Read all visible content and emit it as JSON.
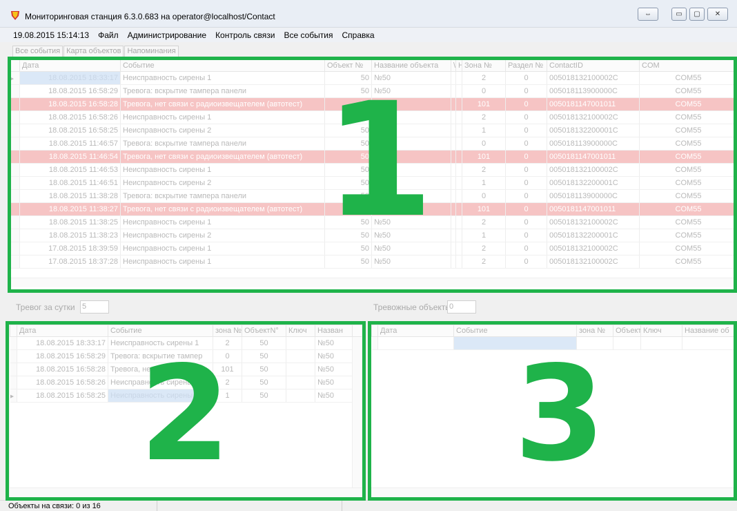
{
  "window": {
    "title": "Мониторинговая станция 6.3.0.683 на operator@localhost/Contact"
  },
  "menu": {
    "datetime": "19.08.2015 15:14:13",
    "items": [
      "Файл",
      "Администрирование",
      "Контроль связи",
      "Все события",
      "Справка"
    ]
  },
  "tabs": [
    "Все события",
    "Карта объектов",
    "Напоминания"
  ],
  "main_grid": {
    "columns": [
      "Дата",
      "Событие",
      "Объект №",
      "Название объекта",
      "\\",
      "H",
      "Зона №",
      "Раздел №",
      "ContactID",
      "COM"
    ],
    "rows": [
      {
        "date": "18.08.2015 18:33:17",
        "event": "Неисправность сирены 1",
        "object": "50",
        "name": "№50",
        "zone": "2",
        "part": "0",
        "cid": "005018132100002C",
        "com": "COM55",
        "alarm": false
      },
      {
        "date": "18.08.2015 16:58:29",
        "event": "Тревога: вскрытие тампера панели",
        "object": "50",
        "name": "№50",
        "zone": "0",
        "part": "0",
        "cid": "005018113900000C",
        "com": "COM55",
        "alarm": false
      },
      {
        "date": "18.08.2015 16:58:28",
        "event": "Тревога, нет связи с радиоизвещателем (автотест)",
        "object": "50",
        "name": "№50",
        "zone": "101",
        "part": "0",
        "cid": "0050181147001011",
        "com": "COM55",
        "alarm": true
      },
      {
        "date": "18.08.2015 16:58:26",
        "event": "Неисправность сирены 1",
        "object": "50",
        "name": "№50",
        "zone": "2",
        "part": "0",
        "cid": "005018132100002C",
        "com": "COM55",
        "alarm": false
      },
      {
        "date": "18.08.2015 16:58:25",
        "event": "Неисправность сирены 2",
        "object": "50",
        "name": "№50",
        "zone": "1",
        "part": "0",
        "cid": "005018132200001C",
        "com": "COM55",
        "alarm": false
      },
      {
        "date": "18.08.2015 11:46:57",
        "event": "Тревога: вскрытие тампера панели",
        "object": "50",
        "name": "№50",
        "zone": "0",
        "part": "0",
        "cid": "005018113900000C",
        "com": "COM55",
        "alarm": false
      },
      {
        "date": "18.08.2015 11:46:54",
        "event": "Тревога, нет связи с радиоизвещателем (автотест)",
        "object": "50",
        "name": "№50",
        "zone": "101",
        "part": "0",
        "cid": "0050181147001011",
        "com": "COM55",
        "alarm": true
      },
      {
        "date": "18.08.2015 11:46:53",
        "event": "Неисправность сирены 1",
        "object": "50",
        "name": "№50",
        "zone": "2",
        "part": "0",
        "cid": "005018132100002C",
        "com": "COM55",
        "alarm": false
      },
      {
        "date": "18.08.2015 11:46:51",
        "event": "Неисправность сирены 2",
        "object": "50",
        "name": "№50",
        "zone": "1",
        "part": "0",
        "cid": "005018132200001C",
        "com": "COM55",
        "alarm": false
      },
      {
        "date": "18.08.2015 11:38:28",
        "event": "Тревога: вскрытие тампера панели",
        "object": "50",
        "name": "№50",
        "zone": "0",
        "part": "0",
        "cid": "005018113900000C",
        "com": "COM55",
        "alarm": false
      },
      {
        "date": "18.08.2015 11:38:27",
        "event": "Тревога, нет связи с радиоизвещателем (автотест)",
        "object": "50",
        "name": "№50",
        "zone": "101",
        "part": "0",
        "cid": "0050181147001011",
        "com": "COM55",
        "alarm": true
      },
      {
        "date": "18.08.2015 11:38:25",
        "event": "Неисправность сирены 1",
        "object": "50",
        "name": "№50",
        "zone": "2",
        "part": "0",
        "cid": "005018132100002C",
        "com": "COM55",
        "alarm": false
      },
      {
        "date": "18.08.2015 11:38:23",
        "event": "Неисправность сирены 2",
        "object": "50",
        "name": "№50",
        "zone": "1",
        "part": "0",
        "cid": "005018132200001C",
        "com": "COM55",
        "alarm": false
      },
      {
        "date": "17.08.2015 18:39:59",
        "event": "Неисправность сирены 1",
        "object": "50",
        "name": "№50",
        "zone": "2",
        "part": "0",
        "cid": "005018132100002C",
        "com": "COM55",
        "alarm": false
      },
      {
        "date": "17.08.2015 18:37:28",
        "event": "Неисправность сирены 1",
        "object": "50",
        "name": "№50",
        "zone": "2",
        "part": "0",
        "cid": "005018132100002C",
        "com": "COM55",
        "alarm": false
      }
    ]
  },
  "counters": {
    "alarms_label": "Тревог за сутки",
    "alarms_value": "5",
    "objects_label": "Тревожные объекты",
    "objects_value": "0"
  },
  "left_grid": {
    "columns": [
      "Дата",
      "Событие",
      "зона №",
      "ОбъектN°",
      "Ключ",
      "Назван"
    ],
    "rows": [
      {
        "date": "18.08.2015 18:33:17",
        "event": "Неисправность сирены 1",
        "zone": "2",
        "object": "50",
        "key": "",
        "name": "№50"
      },
      {
        "date": "18.08.2015 16:58:29",
        "event": "Тревога: вскрытие тампер",
        "zone": "0",
        "object": "50",
        "key": "",
        "name": "№50"
      },
      {
        "date": "18.08.2015 16:58:28",
        "event": "Тревога, нет связи с",
        "zone": "101",
        "object": "50",
        "key": "",
        "name": "№50"
      },
      {
        "date": "18.08.2015 16:58:26",
        "event": "Неисправность сирены",
        "zone": "2",
        "object": "50",
        "key": "",
        "name": "№50"
      },
      {
        "date": "18.08.2015 16:58:25",
        "event": "Неисправность сирены",
        "zone": "1",
        "object": "50",
        "key": "",
        "name": "№50"
      }
    ]
  },
  "right_grid": {
    "columns": [
      "Дата",
      "Событие",
      "зона №",
      "Объект!",
      "Ключ",
      "Название об"
    ]
  },
  "status": {
    "online": "Объекты на связи: 0 из 16"
  },
  "highlights": [
    "1",
    "2",
    "3"
  ],
  "colors": {
    "highlight": "#1fb34a",
    "alarm_row": "#f6c4c4",
    "selection": "#dbe8f7"
  }
}
